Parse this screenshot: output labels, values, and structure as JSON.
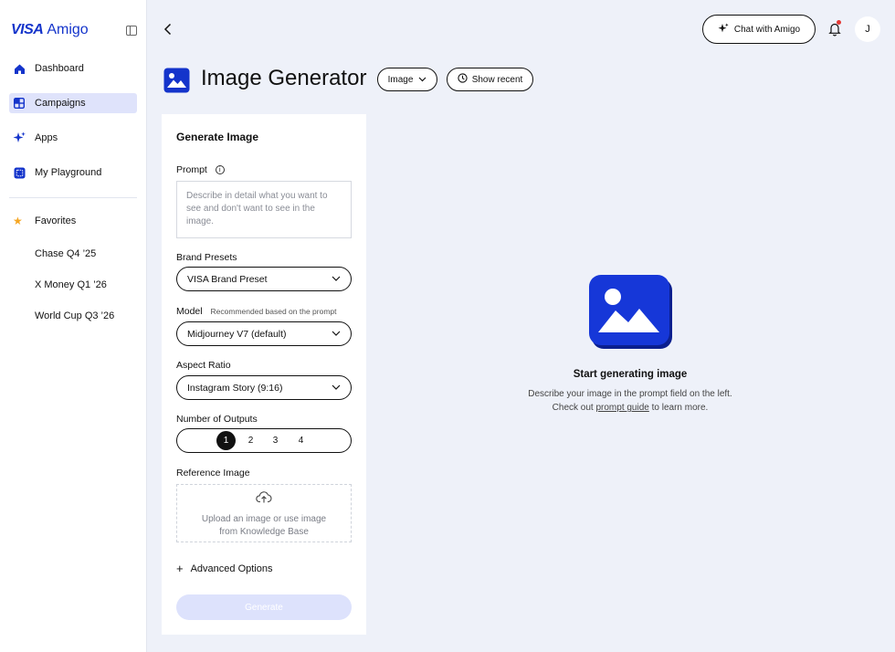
{
  "brand": {
    "visa": "VISA",
    "amigo": "Amigo"
  },
  "nav": [
    {
      "label": "Dashboard",
      "icon": "home-icon"
    },
    {
      "label": "Campaigns",
      "icon": "grid-icon",
      "active": true
    },
    {
      "label": "Apps",
      "icon": "sparkle-icon"
    },
    {
      "label": "My Playground",
      "icon": "playground-icon"
    }
  ],
  "favorites": {
    "label": "Favorites",
    "items": [
      "Chase Q4 ’25",
      "X Money Q1 ’26",
      "World Cup Q3 ’26"
    ]
  },
  "topbar": {
    "chat_label": "Chat with Amigo",
    "avatar_initial": "J"
  },
  "header": {
    "title": "Image Generator",
    "type_label": "Image",
    "recent_label": "Show recent"
  },
  "form": {
    "title": "Generate Image",
    "prompt_label": "Prompt",
    "prompt_placeholder": "Describe in detail what you want to see and don't want to see in the image.",
    "brand_label": "Brand Presets",
    "brand_value": "VISA Brand Preset",
    "model_label": "Model",
    "model_hint": "Recommended based on the prompt",
    "model_value": "Midjourney V7 (default)",
    "aspect_label": "Aspect Ratio",
    "aspect_value": "Instagram Story (9:16)",
    "outputs_label": "Number of Outputs",
    "outputs_options": [
      "1",
      "2",
      "3",
      "4"
    ],
    "outputs_selected": "1",
    "reference_label": "Reference Image",
    "upload_text": "Upload an image or use  image from Knowledge Base",
    "advanced_label": "Advanced Options",
    "generate_label": "Generate"
  },
  "empty_state": {
    "title": "Start generating image",
    "line1": "Describe your image in the prompt field on the left.",
    "line2_pre": "Check out",
    "line2_link": "prompt guide",
    "line2_post": "to learn more."
  },
  "colors": {
    "accent": "#1434cb",
    "active_nav": "#dfe3fb",
    "generate_disabled": "#dde2fc",
    "notification": "#e53935"
  }
}
